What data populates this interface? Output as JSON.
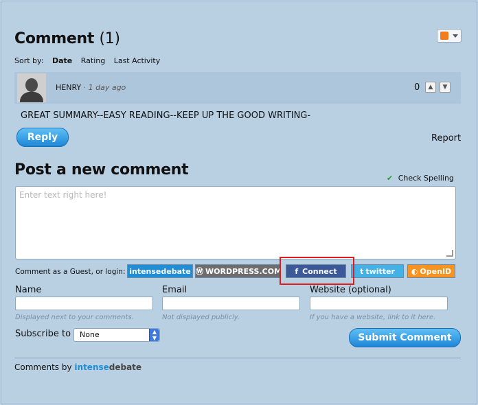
{
  "header": {
    "title": "Comment",
    "count": "(1)",
    "rss_icon": "rss-feed-icon"
  },
  "sort": {
    "label": "Sort by:",
    "options": [
      "Date",
      "Rating",
      "Last Activity"
    ],
    "active": "Date"
  },
  "comment": {
    "author": "HENRY",
    "separator": "·",
    "time": "1 day ago",
    "score": "0",
    "text": "GREAT SUMMARY--EASY READING--KEEP UP THE GOOD WRITING-",
    "reply_label": "Reply",
    "report_label": "Report"
  },
  "post": {
    "title": "Post a new comment",
    "spellcheck_label": "Check Spelling",
    "textarea_placeholder": "Enter text right here!",
    "login_label": "Comment as a Guest, or login:",
    "login_buttons": [
      "intensedebate",
      "WORDPRESS.COM",
      "Connect",
      "twitter",
      "OpenID"
    ],
    "fields": {
      "name_label": "Name",
      "email_label": "Email",
      "website_label": "Website (optional)",
      "name_hint": "Displayed next to your comments.",
      "email_hint": "Not displayed publicly.",
      "website_hint": "If you have a website, link to it here."
    },
    "subscribe_label": "Subscribe to",
    "subscribe_value": "None",
    "submit_label": "Submit Comment"
  },
  "footer": {
    "prefix": "Comments by",
    "brand_a": "intense",
    "brand_b": "debate"
  },
  "colors": {
    "background": "#b9cfe2",
    "button_blue": "#1e86d6",
    "highlight": "#e01b1b",
    "facebook": "#3b5998",
    "openid": "#f7931e"
  }
}
